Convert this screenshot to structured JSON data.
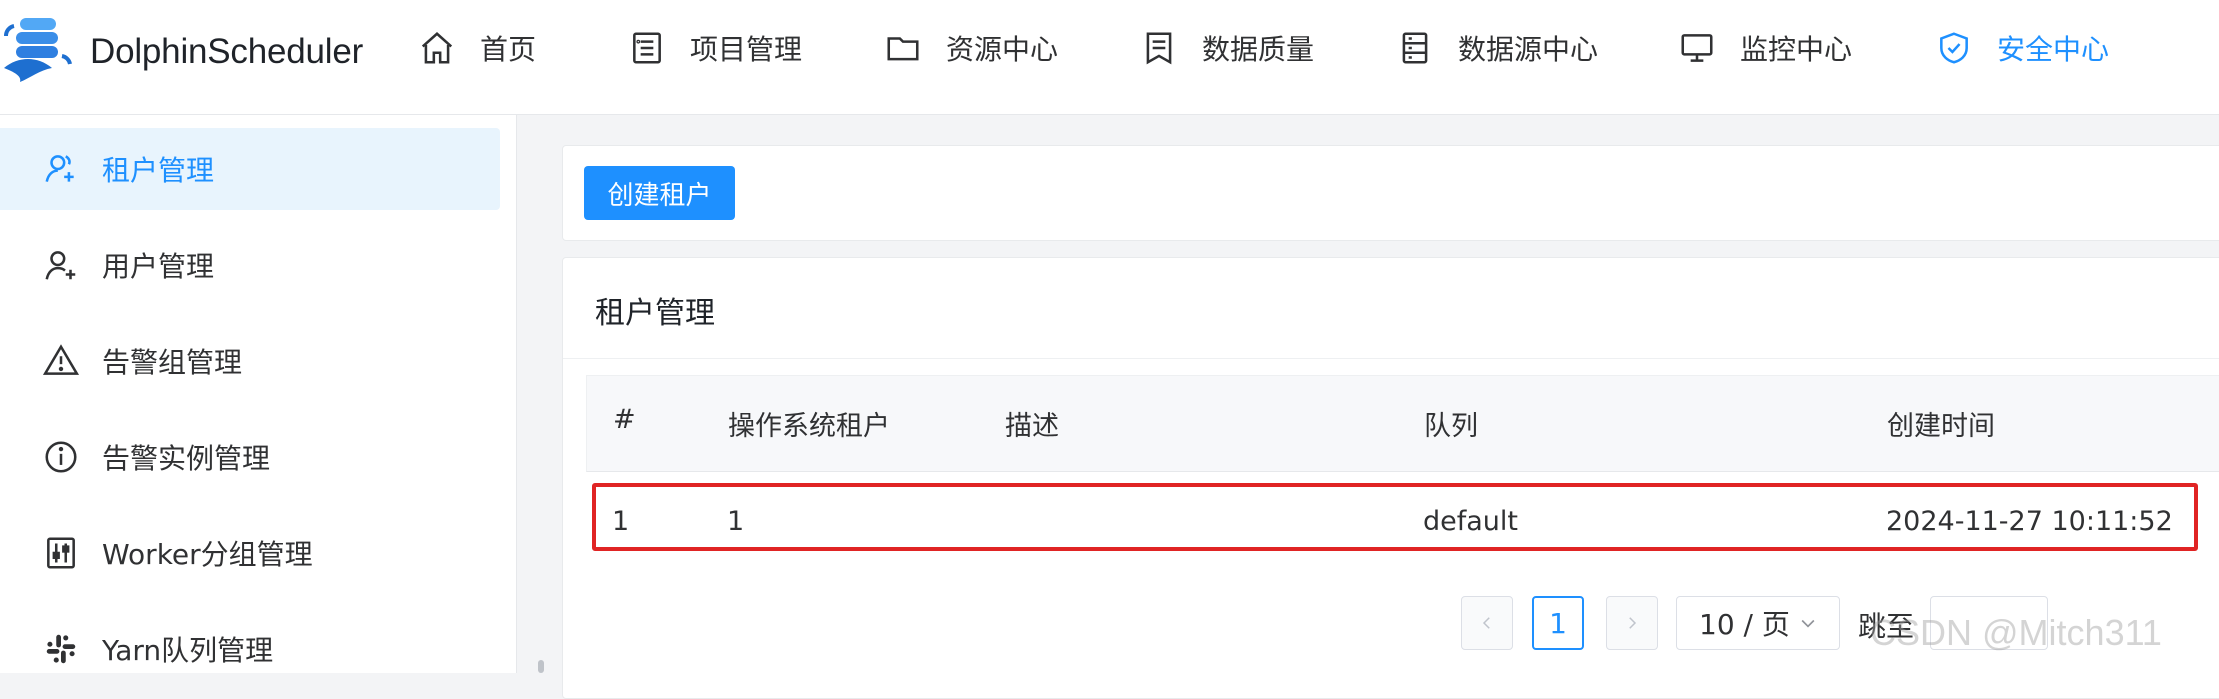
{
  "brand": {
    "name": "DolphinScheduler",
    "logo": "dolphin-logo"
  },
  "nav": [
    {
      "label": "首页",
      "icon": "home-icon",
      "active": false
    },
    {
      "label": "项目管理",
      "icon": "project-list-icon",
      "active": false
    },
    {
      "label": "资源中心",
      "icon": "folder-icon",
      "active": false
    },
    {
      "label": "数据质量",
      "icon": "document-check-icon",
      "active": false
    },
    {
      "label": "数据源中心",
      "icon": "database-icon",
      "active": false
    },
    {
      "label": "监控中心",
      "icon": "monitor-icon",
      "active": false
    },
    {
      "label": "安全中心",
      "icon": "shield-check-icon",
      "active": true
    }
  ],
  "sidebar": {
    "items": [
      {
        "label": "租户管理",
        "icon": "tenant-icon",
        "active": true
      },
      {
        "label": "用户管理",
        "icon": "user-add-icon",
        "active": false
      },
      {
        "label": "告警组管理",
        "icon": "warning-icon",
        "active": false
      },
      {
        "label": "告警实例管理",
        "icon": "info-circle-icon",
        "active": false
      },
      {
        "label": "Worker分组管理",
        "icon": "sliders-icon",
        "active": false
      },
      {
        "label": "Yarn队列管理",
        "icon": "slack-icon",
        "active": false
      }
    ]
  },
  "toolbar": {
    "create_label": "创建租户"
  },
  "table_card": {
    "title": "租户管理",
    "columns": [
      "#",
      "操作系统租户",
      "描述",
      "队列",
      "创建时间"
    ],
    "rows": [
      [
        "1",
        "1",
        "",
        "default",
        "2024-11-27 10:11:52"
      ]
    ]
  },
  "pagination": {
    "current_page": "1",
    "page_size": "10 / 页",
    "jump_label": "跳至",
    "jump_value": ""
  },
  "watermark": "CSDN @Mitch311",
  "colors": {
    "accent": "#1e90ff",
    "highlight_border": "#e02424",
    "active_bg": "#e8f4fd"
  }
}
